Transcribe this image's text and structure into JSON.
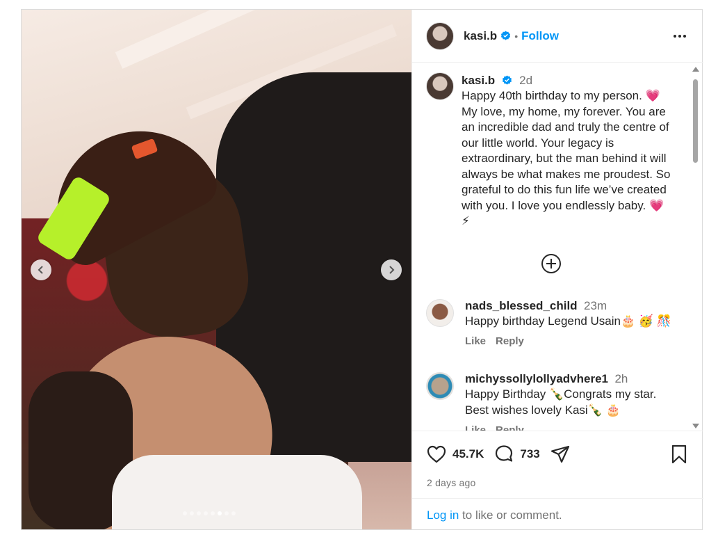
{
  "post": {
    "username": "kasi.b",
    "follow_label": "Follow",
    "separator": "•",
    "caption": {
      "username": "kasi.b",
      "time": "2d",
      "text": "Happy 40th birthday to my person. 💗\nMy love, my home, my forever. You are an incredible dad and truly the centre of our little world. Your legacy is extraordinary, but the man behind it will always be what makes me proudest. So grateful to do this fun life we’ve created with you. I love you endlessly baby. 💗\n⚡"
    },
    "comments": [
      {
        "username": "nads_blessed_child",
        "time": "23m",
        "text": "Happy birthday Legend Usain🎂 🥳 🎊",
        "like_label": "Like",
        "reply_label": "Reply"
      },
      {
        "username": "michyssollylollyadvhere1",
        "time": "2h",
        "text": "Happy Birthday 🍾Congrats my star.\nBest wishes lovely Kasi🍾 🎂",
        "like_label": "Like",
        "reply_label": "Reply"
      }
    ],
    "likes": "45.7K",
    "comments_count": "733",
    "posted": "2 days ago",
    "login_link": "Log in",
    "login_rest": " to like or comment.",
    "carousel": {
      "total": 8,
      "active": 6
    }
  },
  "colors": {
    "accent": "#0095f6",
    "verified": "#0095f6",
    "text": "#262626",
    "muted": "#737373"
  },
  "icons": [
    "verified-badge-icon",
    "more-options-icon",
    "chevron-left-icon",
    "chevron-right-icon",
    "add-circle-icon",
    "heart-icon",
    "comment-icon",
    "share-icon",
    "bookmark-icon"
  ]
}
